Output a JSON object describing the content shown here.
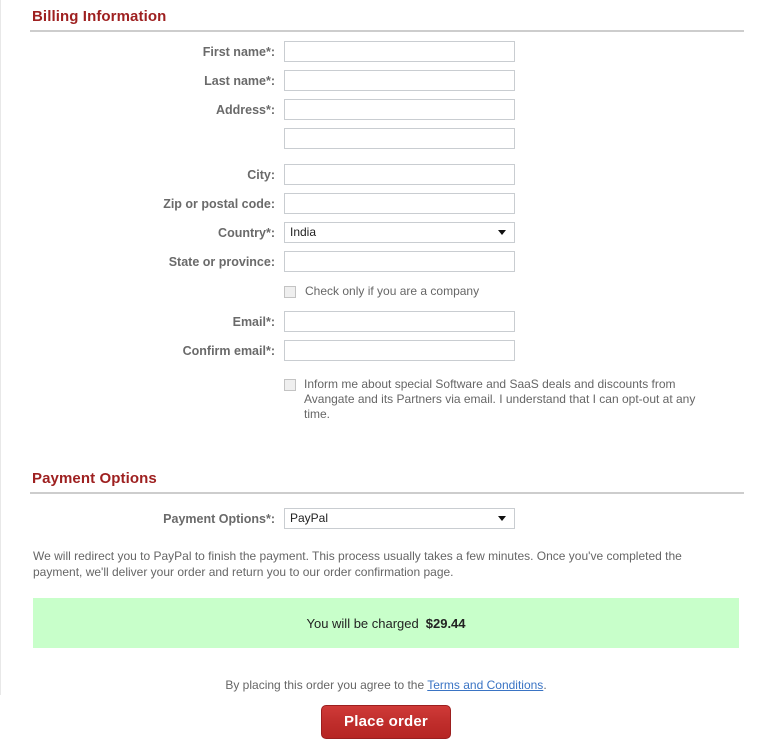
{
  "billing": {
    "title": "Billing Information",
    "fields": [
      {
        "label": "First name*:",
        "value": "",
        "type": "text",
        "name": "first-name"
      },
      {
        "label": "Last name*:",
        "value": "",
        "type": "text",
        "name": "last-name"
      },
      {
        "label": "Address*:",
        "value": "",
        "type": "text",
        "name": "address-line-1"
      },
      {
        "label": "",
        "value": "",
        "type": "text",
        "name": "address-line-2"
      },
      {
        "label": "City:",
        "value": "",
        "type": "text",
        "name": "city"
      },
      {
        "label": "Zip or postal code:",
        "value": "",
        "type": "text",
        "name": "zip-code"
      },
      {
        "label": "Country*:",
        "value": "India",
        "type": "select",
        "name": "country"
      },
      {
        "label": "State or province:",
        "value": "",
        "type": "text",
        "name": "state-province"
      }
    ],
    "company_checkbox": {
      "label": "Check only if you are a company",
      "checked": false
    },
    "email_fields": [
      {
        "label": "Email*:",
        "value": "",
        "type": "text",
        "name": "email"
      },
      {
        "label": "Confirm email*:",
        "value": "",
        "type": "text",
        "name": "confirm-email"
      }
    ],
    "newsletter_checkbox": {
      "label": "Inform me about special Software and SaaS deals and discounts from Avangate and its Partners via email. I understand that I can opt-out at any time.",
      "checked": false
    }
  },
  "payment": {
    "title": "Payment Options",
    "selector_label": "Payment Options*:",
    "selector_value": "PayPal",
    "note": "We will redirect you to PayPal to finish the payment. This process usually takes a few minutes. Once you've completed the payment, we'll deliver your order and return you to our order confirmation page.",
    "charge_text": "You will be charged",
    "charge_amount": "$29.44"
  },
  "footer": {
    "terms_prefix": "By placing this order you agree to the ",
    "terms_link": "Terms and Conditions",
    "terms_suffix": ".",
    "place_order_label": "Place order"
  },
  "colors": {
    "heading": "#9e2020",
    "charge_box": "#c8ffca",
    "button": "#c02e2c",
    "link": "#3a74c4"
  }
}
